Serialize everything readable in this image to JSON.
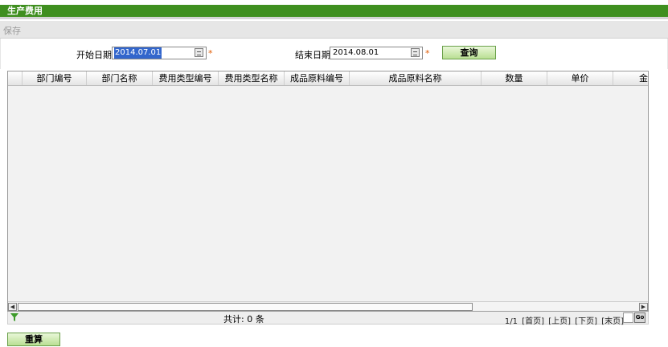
{
  "title": "生产费用",
  "toolbar": {
    "save_label": "保存"
  },
  "form": {
    "start_label": "开始日期",
    "start_value": "2014.07.01",
    "end_label": "结束日期",
    "end_value": "2014.08.01",
    "required_mark": "*",
    "query_label": "查询"
  },
  "grid": {
    "columns": [
      "部门编号",
      "部门名称",
      "费用类型编号",
      "费用类型名称",
      "成品原料编号",
      "成品原料名称",
      "数量",
      "单价",
      "金"
    ],
    "rows": []
  },
  "footer": {
    "total_text": "共计: 0 条",
    "page_info": "1/1",
    "first": "[首页]",
    "prev": "[上页]",
    "next": "[下页]",
    "last": "[末页]",
    "go_label": "Go"
  },
  "recalc_label": "重算",
  "colors": {
    "title_bg": "#3f8f1f",
    "button_bg": "#b9df93",
    "required": "#e05a00"
  }
}
